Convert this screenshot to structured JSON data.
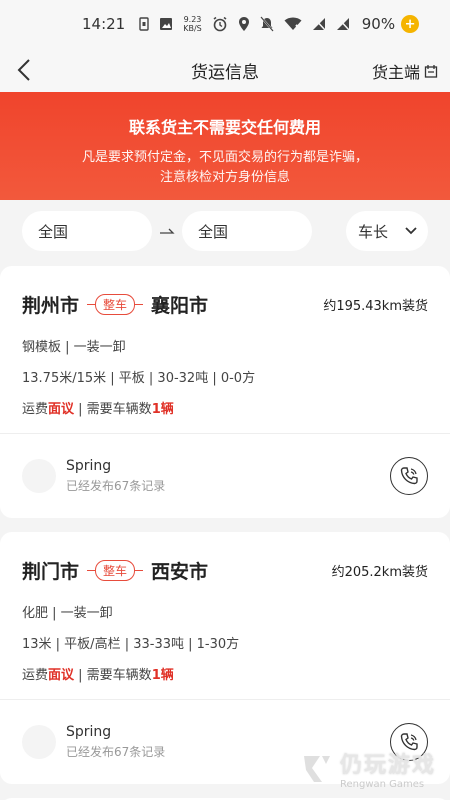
{
  "status_bar": {
    "time": "14:21",
    "speed_value": "9.23",
    "speed_unit": "KB/S",
    "battery": "90%"
  },
  "nav": {
    "title": "货运信息",
    "shipper_label": "货主端"
  },
  "banner": {
    "headline": "联系货主不需要交任何费用",
    "line1": "凡是要求预付定金，不见面交易的行为都是诈骗，",
    "line2": "注意核检对方身份信息"
  },
  "filters": {
    "from": "全国",
    "to": "全国",
    "length": "车长"
  },
  "cards": [
    {
      "from": "荆州市",
      "tag": "整车",
      "to": "襄阳市",
      "distance": "约195.43km装货",
      "cargo": "钢模板 | 一装一卸",
      "specs": "13.75米/15米 | 平板 | 30-32吨 | 0-0方",
      "fee_label": "运费",
      "fee_value": "面议",
      "vehicles_label": " | 需要车辆数",
      "vehicles_value": "1辆",
      "user": "Spring",
      "records": "已经发布67条记录"
    },
    {
      "from": "荆门市",
      "tag": "整车",
      "to": "西安市",
      "distance": "约205.2km装货",
      "cargo": "化肥 | 一装一卸",
      "specs": "13米 | 平板/高栏 | 33-33吨 | 1-30方",
      "fee_label": "运费",
      "fee_value": "面议",
      "vehicles_label": " | 需要车辆数",
      "vehicles_value": "1辆",
      "user": "Spring",
      "records": "已经发布67条记录"
    }
  ],
  "watermark": {
    "cn": "仍玩游戏",
    "en": "Rengwan Games"
  }
}
